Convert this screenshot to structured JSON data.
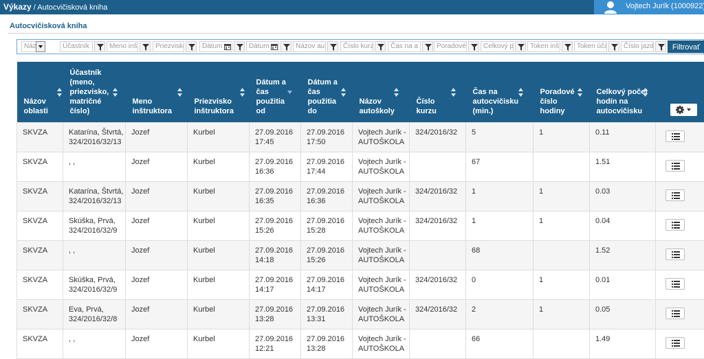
{
  "header": {
    "app_title": "Výkazy",
    "breadcrumb_sep": " / ",
    "breadcrumb_current": "Autocvičisková kniha",
    "user_name": "Vojtech Jurík (1000922)"
  },
  "page": {
    "title": "Autocvičisková kniha"
  },
  "filters": {
    "placeholders": [
      "Náz",
      "Účastník",
      "Meno inš",
      "Priezvisko",
      "Dátum",
      "Dátum",
      "Názov aut",
      "Číslo kurz",
      "Čas na a",
      "Poradové",
      "Celkový p",
      "Token inš",
      "Token úča",
      "Číslo jazd"
    ],
    "submit_label": "Filtrovať"
  },
  "table": {
    "columns": [
      [
        "Názov",
        "oblasti"
      ],
      [
        "Účastník",
        "(meno,",
        "priezvisko,",
        "matričné",
        "číslo)"
      ],
      [
        "Meno",
        "inštruktora"
      ],
      [
        "Priezvisko",
        "inštruktora"
      ],
      [
        "Dátum a",
        "čas",
        "použitia",
        "od"
      ],
      [
        "Dátum a",
        "čas",
        "použitia",
        "do"
      ],
      [
        "Názov",
        "autoškoly"
      ],
      [
        "Číslo",
        "kurzu"
      ],
      [
        "Čas na",
        "autocvičisku",
        "(min.)"
      ],
      [
        "Poradové",
        "číslo",
        "hodiny"
      ],
      [
        "Celkový počet",
        "hodín na",
        "autocvičisku"
      ]
    ],
    "rows": [
      {
        "oblast": "SKVZA",
        "ucastnik": [
          "Katarína, Štvrtá,",
          "324/2016/32/13"
        ],
        "meno": "Jozef",
        "priezvisko": "Kurbel",
        "od": [
          "27.09.2016",
          "17:45"
        ],
        "do": [
          "27.09.2016",
          "17:50"
        ],
        "autoskola": [
          "Vojtech Jurík -",
          "AUTOŠKOLA"
        ],
        "kurz": "324/2016/32",
        "cas": "5",
        "poradove": "1",
        "celkovy": "0.11"
      },
      {
        "oblast": "SKVZA",
        "ucastnik": [
          ", ,",
          ""
        ],
        "meno": "Jozef",
        "priezvisko": "Kurbel",
        "od": [
          "27.09.2016",
          "16:36"
        ],
        "do": [
          "27.09.2016",
          "17:44"
        ],
        "autoskola": [
          "Vojtech Jurík -",
          "AUTOŠKOLA"
        ],
        "kurz": "",
        "cas": "67",
        "poradove": "",
        "celkovy": "1.51"
      },
      {
        "oblast": "SKVZA",
        "ucastnik": [
          "Katarína, Štvrtá,",
          "324/2016/32/13"
        ],
        "meno": "Jozef",
        "priezvisko": "Kurbel",
        "od": [
          "27.09.2016",
          "16:35"
        ],
        "do": [
          "27.09.2016",
          "16:36"
        ],
        "autoskola": [
          "Vojtech Jurík -",
          "AUTOŠKOLA"
        ],
        "kurz": "324/2016/32",
        "cas": "1",
        "poradove": "1",
        "celkovy": "0.03"
      },
      {
        "oblast": "SKVZA",
        "ucastnik": [
          "Skúška, Prvá,",
          "324/2016/32/9"
        ],
        "meno": "Jozef",
        "priezvisko": "Kurbel",
        "od": [
          "27.09.2016",
          "15:26"
        ],
        "do": [
          "27.09.2016",
          "15:28"
        ],
        "autoskola": [
          "Vojtech Jurík -",
          "AUTOŠKOLA"
        ],
        "kurz": "324/2016/32",
        "cas": "1",
        "poradove": "1",
        "celkovy": "0.04"
      },
      {
        "oblast": "SKVZA",
        "ucastnik": [
          ", ,",
          ""
        ],
        "meno": "Jozef",
        "priezvisko": "Kurbel",
        "od": [
          "27.09.2016",
          "14:18"
        ],
        "do": [
          "27.09.2016",
          "15:26"
        ],
        "autoskola": [
          "Vojtech Jurík -",
          "AUTOŠKOLA"
        ],
        "kurz": "",
        "cas": "68",
        "poradove": "",
        "celkovy": "1.52"
      },
      {
        "oblast": "SKVZA",
        "ucastnik": [
          "Skúška, Prvá,",
          "324/2016/32/9"
        ],
        "meno": "Jozef",
        "priezvisko": "Kurbel",
        "od": [
          "27.09.2016",
          "14:17"
        ],
        "do": [
          "27.09.2016",
          "14:17"
        ],
        "autoskola": [
          "Vojtech Jurík -",
          "AUTOŠKOLA"
        ],
        "kurz": "324/2016/32",
        "cas": "0",
        "poradove": "1",
        "celkovy": "0.01"
      },
      {
        "oblast": "SKVZA",
        "ucastnik": [
          "Eva, Prvá,",
          "324/2016/32/8"
        ],
        "meno": "Jozef",
        "priezvisko": "Kurbel",
        "od": [
          "27.09.2016",
          "13:28"
        ],
        "do": [
          "27.09.2016",
          "13:31"
        ],
        "autoskola": [
          "Vojtech Jurík -",
          "AUTOŠKOLA"
        ],
        "kurz": "324/2016/32",
        "cas": "2",
        "poradove": "1",
        "celkovy": "0.05"
      },
      {
        "oblast": "SKVZA",
        "ucastnik": [
          ", ,",
          ""
        ],
        "meno": "Jozef",
        "priezvisko": "Kurbel",
        "od": [
          "27.09.2016",
          "12:21"
        ],
        "do": [
          "27.09.2016",
          "13:28"
        ],
        "autoskola": [
          "Vojtech Jurík -",
          "AUTOŠKOLA"
        ],
        "kurz": "",
        "cas": "66",
        "poradove": "",
        "celkovy": "1.49"
      }
    ],
    "sorted_column_index": 4,
    "sort_direction": "descending"
  },
  "colors": {
    "header_bg": "#1d5f8a",
    "user_bg": "#3a8fd0",
    "row_alt": "#f5f5f5"
  }
}
